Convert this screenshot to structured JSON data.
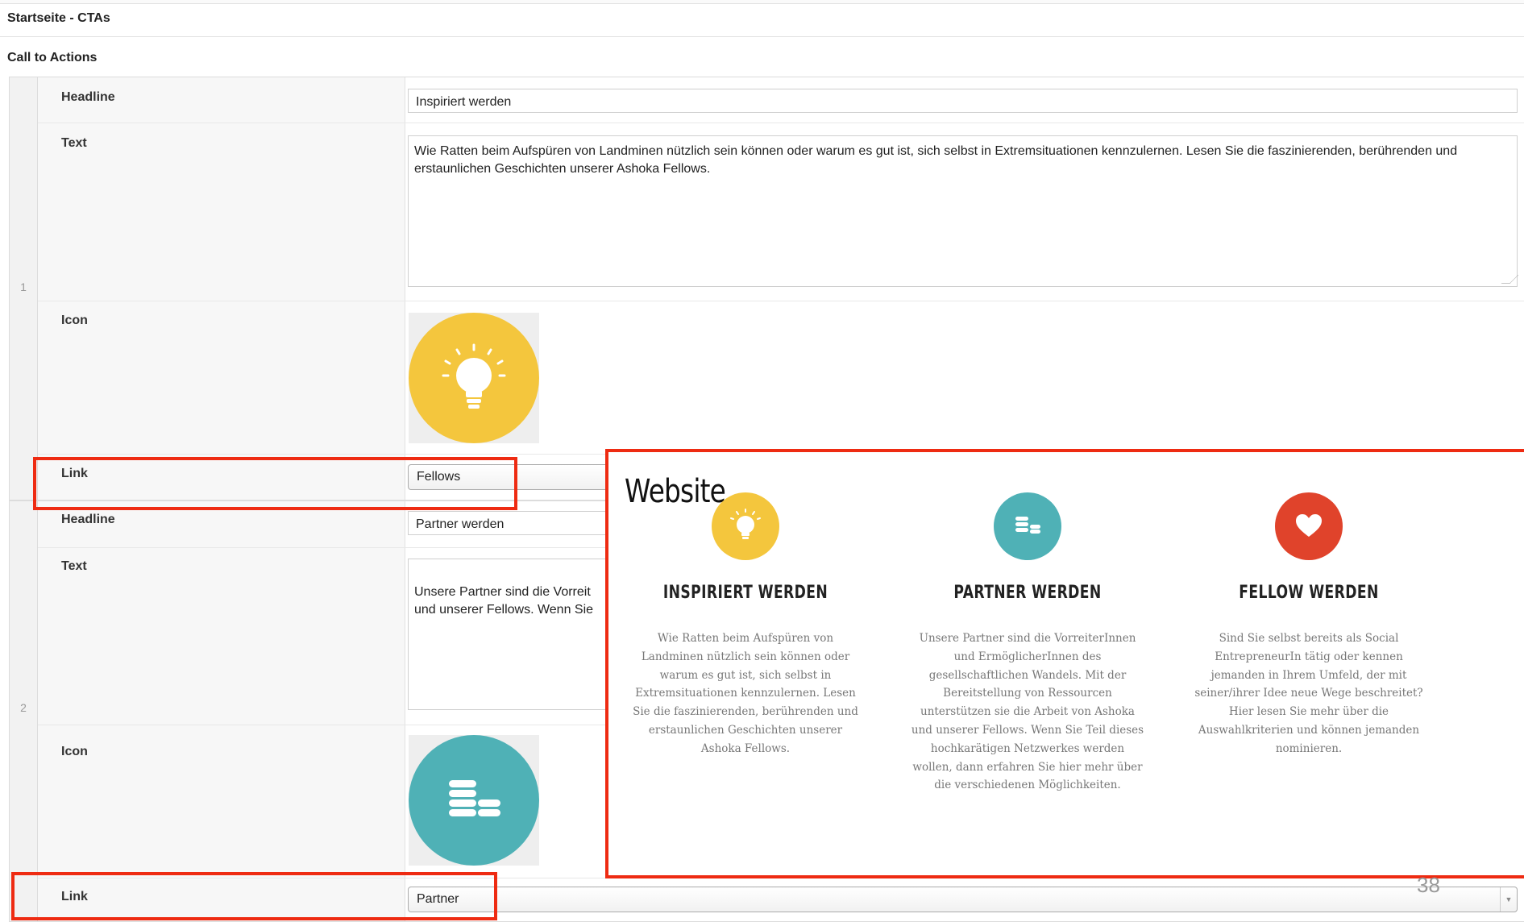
{
  "header": {
    "section_title": "Startseite - CTAs",
    "subsection_title": "Call to Actions"
  },
  "rows": [
    {
      "number": "1",
      "headline_label": "Headline",
      "headline_value": "Inspiriert werden",
      "text_label": "Text",
      "text_value": "Wie Ratten beim Aufspüren von Landminen nützlich sein können oder warum es gut ist, sich selbst in Extremsituationen kennzulernen. Lesen Sie die faszinierenden, berührenden und erstaunlichen Geschichten unserer Ashoka Fellows.",
      "icon_label": "Icon",
      "icon": "lightbulb-icon",
      "icon_color": "#f4c63d",
      "link_label": "Link",
      "link_value": "Fellows"
    },
    {
      "number": "2",
      "headline_label": "Headline",
      "headline_value": "Partner werden",
      "text_label": "Text",
      "text_value": "Unsere Partner sind die Vorreit\nund unserer Fellows. Wenn Sie",
      "icon_label": "Icon",
      "icon": "coins-icon",
      "icon_color": "#4fb1b6",
      "link_label": "Link",
      "link_value": "Partner"
    }
  ],
  "website_preview": {
    "label": "Website",
    "columns": [
      {
        "icon": "lightbulb-icon",
        "color": "#f4c63d",
        "title": "INSPIRIERT WERDEN",
        "text": "Wie Ratten beim Aufspüren von Landminen nützlich sein können oder warum es gut ist, sich selbst in Extremsituationen kennzulernen. Lesen Sie die faszinierenden, berührenden und erstaunlichen Geschichten unserer Ashoka Fellows."
      },
      {
        "icon": "coins-icon",
        "color": "#4fb1b6",
        "title": "PARTNER WERDEN",
        "text": "Unsere Partner sind die VorreiterInnen und ErmöglicherInnen des gesellschaftlichen Wandels. Mit der Bereitstellung von Ressourcen unterstützen sie die Arbeit von Ashoka und unserer Fellows. Wenn Sie Teil dieses hochkarätigen Netzwerkes werden wollen, dann erfahren Sie hier mehr über die verschiedenen Möglichkeiten."
      },
      {
        "icon": "heart-icon",
        "color": "#e0432b",
        "title": "FELLOW WERDEN",
        "text": "Sind Sie selbst bereits als Social EntrepreneurIn tätig oder kennen jemanden in Ihrem Umfeld, der mit seiner/ihrer Idee neue Wege beschreitet? Hier lesen Sie mehr über die Auswahlkriterien und können jemanden nominieren."
      }
    ]
  },
  "page_number": "38"
}
